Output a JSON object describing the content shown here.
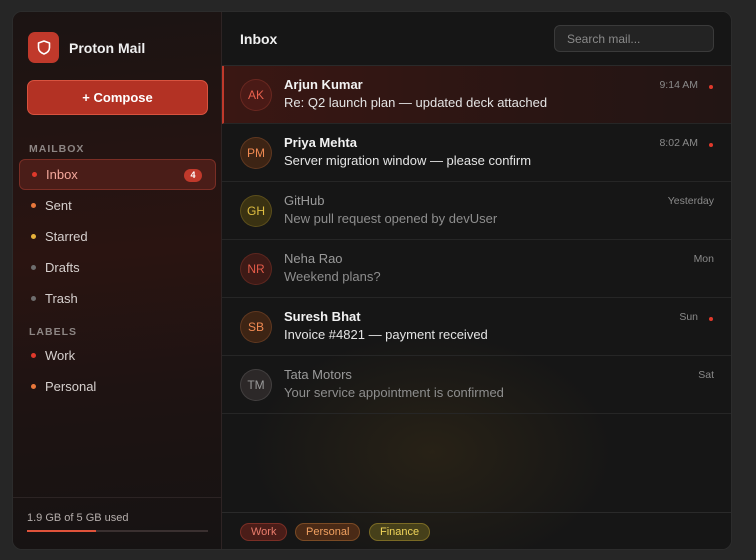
{
  "app": {
    "name": "Proton Mail",
    "logo_icon": "shield-icon",
    "accent": "#c0392b"
  },
  "compose": {
    "label": "+ Compose"
  },
  "sidebar": {
    "mailbox_label": "MAILBOX",
    "labels_label": "LABELS",
    "mailbox": [
      {
        "label": "Inbox",
        "badge": "4",
        "dot_color": "#e0392b",
        "active": true
      },
      {
        "label": "Sent",
        "dot_color": "#e8773b"
      },
      {
        "label": "Starred",
        "dot_color": "#e6b13a"
      },
      {
        "label": "Drafts",
        "dot_color": "#6e6e6e"
      },
      {
        "label": "Trash",
        "dot_color": "#6e6e6e"
      }
    ],
    "labels": [
      {
        "label": "Work",
        "dot_color": "#e0392b"
      },
      {
        "label": "Personal",
        "dot_color": "#e8773b"
      }
    ],
    "storage": {
      "text": "1.9 GB of 5 GB used",
      "used_fraction": 0.38
    }
  },
  "main": {
    "title": "Inbox",
    "search_placeholder": "Search mail...",
    "messages": [
      {
        "initials": "AK",
        "sender": "Arjun Kumar",
        "subject": "Re: Q2 launch plan — updated deck attached",
        "time": "9:14 AM",
        "unread": true,
        "selected": true,
        "avatar_bg": "#4a1a16",
        "avatar_fg": "#e8604d"
      },
      {
        "initials": "PM",
        "sender": "Priya Mehta",
        "subject": "Server migration window — please confirm",
        "time": "8:02 AM",
        "unread": true,
        "avatar_bg": "#3d2414",
        "avatar_fg": "#f08a52"
      },
      {
        "initials": "GH",
        "sender": "GitHub",
        "subject": "New pull request opened by devUser",
        "time": "Yesterday",
        "unread": false,
        "avatar_bg": "#3a3212",
        "avatar_fg": "#e0bf42"
      },
      {
        "initials": "NR",
        "sender": "Neha Rao",
        "subject": "Weekend plans?",
        "time": "Mon",
        "unread": false,
        "avatar_bg": "#3d1a16",
        "avatar_fg": "#e25a48"
      },
      {
        "initials": "SB",
        "sender": "Suresh Bhat",
        "subject": "Invoice #4821 — payment received",
        "time": "Sun",
        "unread": true,
        "avatar_bg": "#3d2414",
        "avatar_fg": "#f08a52"
      },
      {
        "initials": "TM",
        "sender": "Tata Motors",
        "subject": "Your service appointment is confirmed",
        "time": "Sat",
        "unread": false,
        "avatar_bg": "#2c2828",
        "avatar_fg": "#9a9a9a"
      }
    ],
    "tags": [
      {
        "label": "Work",
        "bg": "#4a1d18",
        "fg": "#e87c6c",
        "border": "#7a2e25"
      },
      {
        "label": "Personal",
        "bg": "#4a2a16",
        "fg": "#f0a060",
        "border": "#7a4a24"
      },
      {
        "label": "Finance",
        "bg": "#46401a",
        "fg": "#f0d55a",
        "border": "#7a6a24"
      }
    ]
  }
}
